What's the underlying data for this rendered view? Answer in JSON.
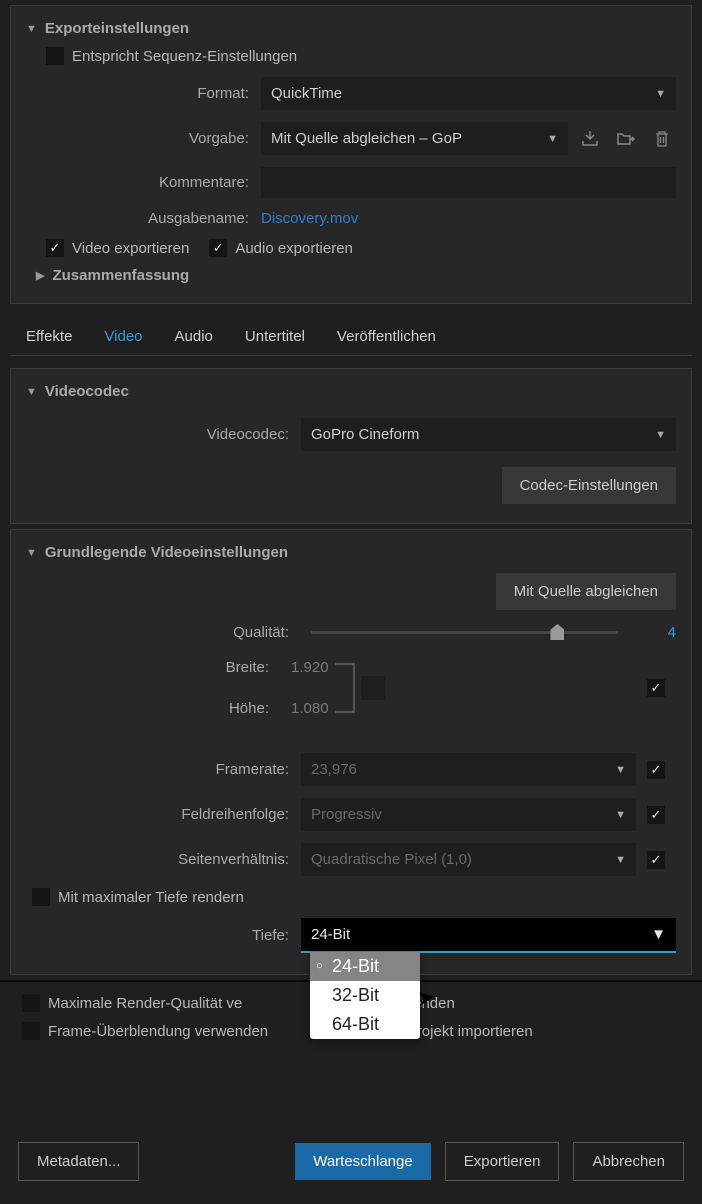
{
  "export_settings": {
    "title": "Exporteinstellungen",
    "match_sequence_label": "Entspricht Sequenz-Einstellungen",
    "format_label": "Format:",
    "format_value": "QuickTime",
    "preset_label": "Vorgabe:",
    "preset_value": "Mit Quelle abgleichen – GoP",
    "comments_label": "Kommentare:",
    "comments_value": "",
    "output_name_label": "Ausgabename:",
    "output_name_value": "Discovery.mov",
    "export_video_label": "Video exportieren",
    "export_audio_label": "Audio exportieren",
    "summary_label": "Zusammenfassung"
  },
  "tabs": {
    "effects": "Effekte",
    "video": "Video",
    "audio": "Audio",
    "subtitles": "Untertitel",
    "publish": "Veröffentlichen"
  },
  "video_codec": {
    "title": "Videocodec",
    "label": "Videocodec:",
    "value": "GoPro Cineform",
    "settings_btn": "Codec-Einstellungen"
  },
  "basic_video": {
    "title": "Grundlegende Videoeinstellungen",
    "match_source_btn": "Mit Quelle abgleichen",
    "quality_label": "Qualität:",
    "quality_value": "4",
    "width_label": "Breite:",
    "width_value": "1.920",
    "height_label": "Höhe:",
    "height_value": "1.080",
    "framerate_label": "Framerate:",
    "framerate_value": "23,976",
    "field_order_label": "Feldreihenfolge:",
    "field_order_value": "Progressiv",
    "aspect_label": "Seitenverhältnis:",
    "aspect_value": "Quadratische Pixel (1,0)",
    "max_depth_label": "Mit maximaler Tiefe rendern",
    "depth_label": "Tiefe:",
    "depth_value": "24-Bit",
    "depth_options": [
      "24-Bit",
      "32-Bit",
      "64-Bit"
    ]
  },
  "bottom": {
    "max_render_label": "Maximale Render-Qualität ve",
    "preview_label": "rschau verwenden",
    "frame_blend_label": "Frame-Überblendung verwenden",
    "import_label": "In Projekt importieren"
  },
  "buttons": {
    "metadata": "Metadaten...",
    "queue": "Warteschlange",
    "export": "Exportieren",
    "cancel": "Abbrechen"
  }
}
